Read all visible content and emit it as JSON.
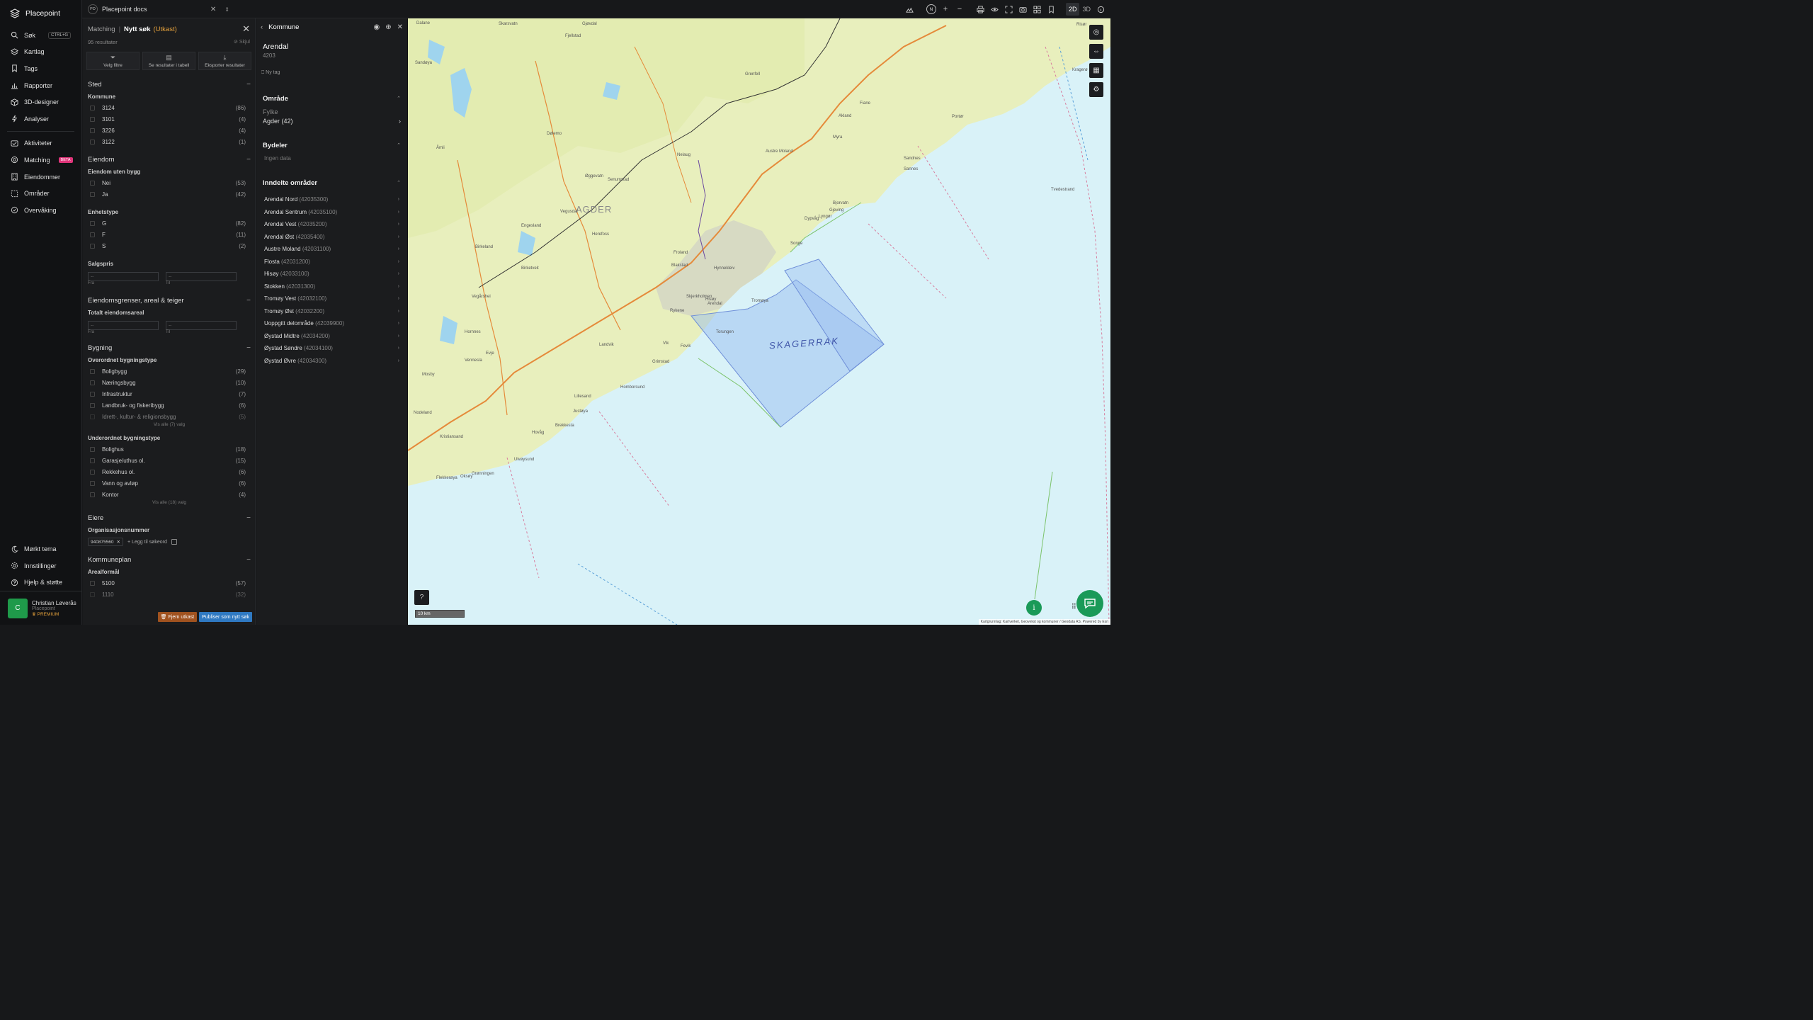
{
  "app": {
    "name": "Placepoint"
  },
  "nav": {
    "search": {
      "label": "Søk",
      "shortcut": "CTRL+G"
    },
    "items_top": [
      "Kartlag",
      "Tags",
      "Rapporter",
      "3D-designer",
      "Analyser"
    ],
    "items_mid": [
      {
        "label": "Aktiviteter"
      },
      {
        "label": "Matching",
        "badge": "BETA"
      },
      {
        "label": "Eiendommer"
      },
      {
        "label": "Områder"
      },
      {
        "label": "Overvåking"
      }
    ],
    "items_bottom": [
      "Mørkt tema",
      "Innstillinger",
      "Hjelp & støtte"
    ]
  },
  "user": {
    "initial": "C",
    "name": "Christian Løverås",
    "org": "Placepoint",
    "tier": "PREMIUM"
  },
  "topbar": {
    "doc_badge": "PD",
    "doc_title": "Placepoint docs",
    "north": "N",
    "view_2d": "2D",
    "view_3d": "3D"
  },
  "filter": {
    "crumb": "Matching",
    "title": "Nytt søk",
    "draft": "(Utkast)",
    "results": "95 resultater",
    "hide": "Skjul",
    "actions": [
      "Velg filtre",
      "Se resultater i tabell",
      "Eksporter resultater"
    ],
    "sted": {
      "title": "Sted",
      "kommune_label": "Kommune",
      "kommune": [
        {
          "label": "3124",
          "count": "(86)"
        },
        {
          "label": "3101",
          "count": "(4)"
        },
        {
          "label": "3226",
          "count": "(4)"
        },
        {
          "label": "3122",
          "count": "(1)"
        }
      ]
    },
    "eiendom": {
      "title": "Eiendom",
      "uten_bygg_label": "Eiendom uten bygg",
      "uten_bygg": [
        {
          "label": "Nei",
          "count": "(53)"
        },
        {
          "label": "Ja",
          "count": "(42)"
        }
      ],
      "enhetstype_label": "Enhetstype",
      "enhetstype": [
        {
          "label": "G",
          "count": "(82)"
        },
        {
          "label": "F",
          "count": "(11)"
        },
        {
          "label": "S",
          "count": "(2)"
        }
      ],
      "salgspris_label": "Salgspris",
      "from_placeholder": "--",
      "to_placeholder": "--",
      "from": "Fra",
      "to": "Til"
    },
    "grenser": {
      "title": "Eiendomsgrenser, areal & teiger",
      "areal_label": "Totalt eiendomsareal"
    },
    "bygning": {
      "title": "Bygning",
      "over_label": "Overordnet bygningstype",
      "over": [
        {
          "label": "Boligbygg",
          "count": "(29)"
        },
        {
          "label": "Næringsbygg",
          "count": "(10)"
        },
        {
          "label": "Infrastruktur",
          "count": "(7)"
        },
        {
          "label": "Landbruk- og fiskeribygg",
          "count": "(6)"
        },
        {
          "label": "Idrett-, kultur- & religionsbygg",
          "count": "(5)"
        }
      ],
      "over_more": "Vis alle (7) valg",
      "under_label": "Underordnet bygningstype",
      "under": [
        {
          "label": "Bolighus",
          "count": "(18)"
        },
        {
          "label": "Garasje/uthus ol.",
          "count": "(15)"
        },
        {
          "label": "Rekkehus ol.",
          "count": "(6)"
        },
        {
          "label": "Vann og avløp",
          "count": "(6)"
        },
        {
          "label": "Kontor",
          "count": "(4)"
        }
      ],
      "under_more": "Vis alle (18) valg"
    },
    "eiere": {
      "title": "Eiere",
      "org_label": "Organisasjonsnummer",
      "chip": "940875560",
      "add": "Legg til søkeord"
    },
    "kommuneplan": {
      "title": "Kommuneplan",
      "areal_label": "Arealformål",
      "rows": [
        {
          "label": "5100",
          "count": "(57)"
        },
        {
          "label": "1110",
          "count": "(32)"
        }
      ]
    },
    "remove_draft": "Fjern utkast",
    "publish": "Publiser som nytt søk"
  },
  "kommune": {
    "header": "Kommune",
    "name": "Arendal",
    "code": "4203",
    "new_tag": "Ny tag",
    "omrade_title": "Område",
    "fylke_label": "Fylke",
    "fylke_value": "Agder (42)",
    "bydeler_title": "Bydeler",
    "bydeler_empty": "Ingen data",
    "inndelte_title": "Inndelte områder",
    "districts": [
      {
        "name": "Arendal Nord",
        "code": "(42035300)"
      },
      {
        "name": "Arendal Sentrum",
        "code": "(42035100)"
      },
      {
        "name": "Arendal Vest",
        "code": "(42035200)"
      },
      {
        "name": "Arendal Øst",
        "code": "(42035400)"
      },
      {
        "name": "Austre Moland",
        "code": "(42031100)"
      },
      {
        "name": "Flosta",
        "code": "(42031200)"
      },
      {
        "name": "Hisøy",
        "code": "(42033100)"
      },
      {
        "name": "Stokken",
        "code": "(42031300)"
      },
      {
        "name": "Tromøy Vest",
        "code": "(42032100)"
      },
      {
        "name": "Tromøy Øst",
        "code": "(42032200)"
      },
      {
        "name": "Uoppgitt delområde",
        "code": "(42039900)"
      },
      {
        "name": "Øystad Midtre",
        "code": "(42034200)"
      },
      {
        "name": "Øystad Søndre",
        "code": "(42034100)"
      },
      {
        "name": "Øystad Øvre",
        "code": "(42034300)"
      }
    ]
  },
  "map": {
    "region_label": "AGDER",
    "sea_label": "SKAGERRAK",
    "scale": "10 km",
    "attribution": "Kartgrunnlag: Kartverket, Geovekst og kommuner / Geodata AS. Powered by Esri",
    "places": [
      "Dalane",
      "Skarsvatn",
      "Gjøvdal",
      "Fjellstad",
      "Risør",
      "Grenfell",
      "Kragerø",
      "Sannes",
      "Fiane",
      "Akland",
      "Portør",
      "Sandnes",
      "Tvedestrand",
      "Dypvåg",
      "Lyngør",
      "Gjeving",
      "Bjorvatn",
      "Vegusdal",
      "Engesland",
      "Birkeland",
      "Herefoss",
      "Froland",
      "Blakstad",
      "Arendal",
      "Hisøy",
      "Rykene",
      "Fevik",
      "Grimstad",
      "Tromøya",
      "Torungen",
      "Landvik",
      "Vik",
      "Lillesand",
      "Homborsund",
      "Justøya",
      "Brekkesta",
      "Kristiansand",
      "Hovåg",
      "Ulvøysund",
      "Grønningen",
      "Oksøy",
      "Flekkerøya",
      "Vennesla",
      "Mosby",
      "Nodeland",
      "Hornnes",
      "Evje",
      "Dølemo",
      "Åmli",
      "Vegårshei",
      "Birketveit",
      "Øggevatn",
      "Senumstad",
      "Hynnekleiv",
      "Nelaug",
      "Austre Moland",
      "Songe",
      "Myra",
      "Sandøya",
      "Skjerkholmen"
    ],
    "colors": {
      "sea": "#d9f2f8",
      "land": "#e7efbf",
      "selection": "#93b8ef",
      "road": "#e58a3a"
    }
  }
}
